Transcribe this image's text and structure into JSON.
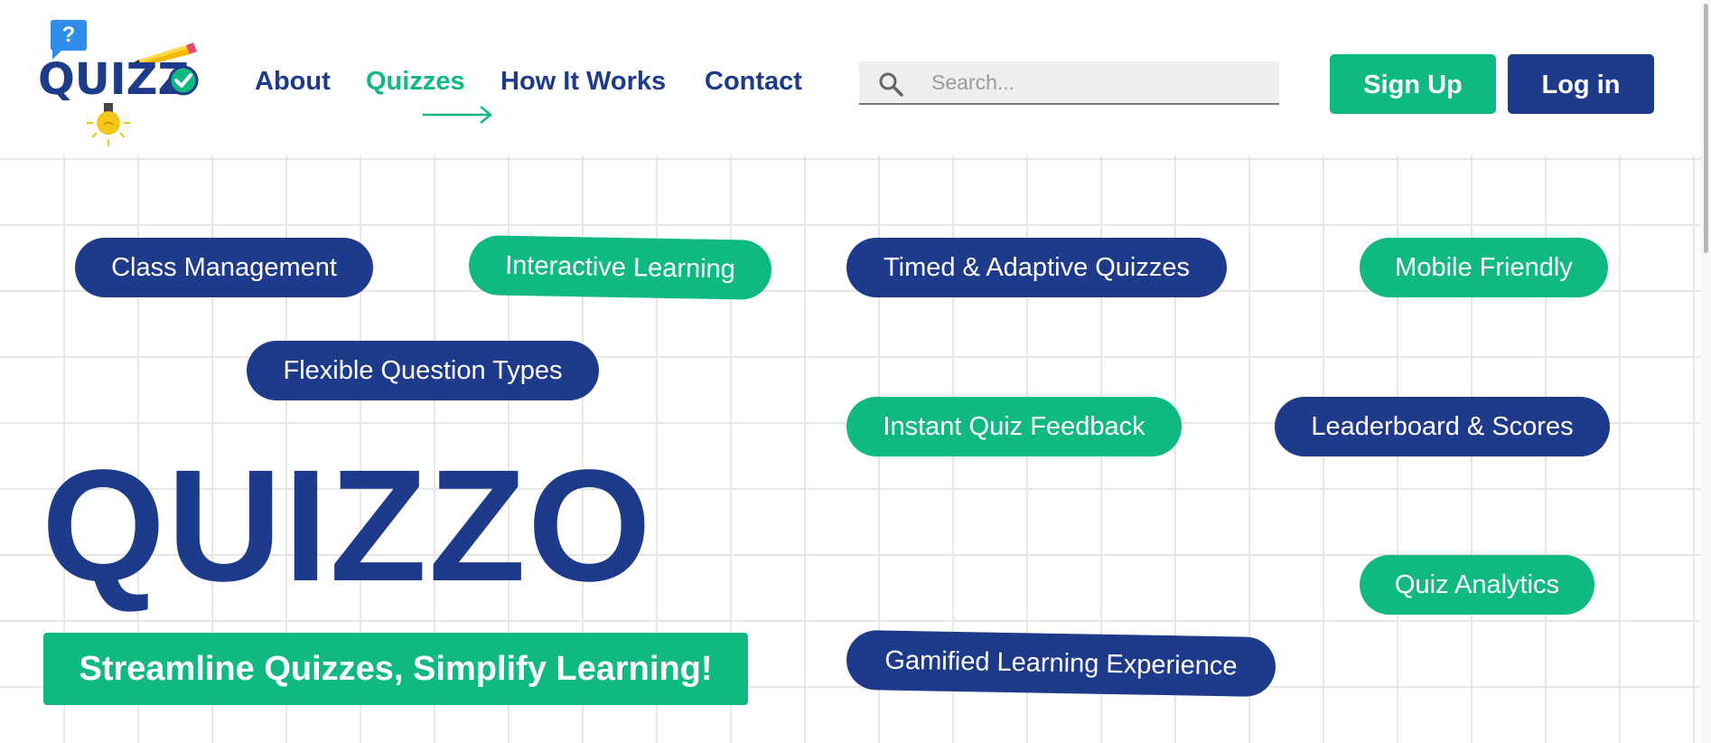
{
  "brand": {
    "logo_text": "QUIZZ",
    "logo_bubble": "?",
    "title": "QUIZZO",
    "tagline": "Streamline Quizzes, Simplify Learning!",
    "colors": {
      "primary": "#1e3a8a",
      "accent": "#10b981",
      "bubble": "#2f8ce8",
      "bulb": "#f5c518"
    }
  },
  "nav": {
    "items": [
      {
        "label": "About",
        "active": false
      },
      {
        "label": "Quizzes",
        "active": true
      },
      {
        "label": "How It Works",
        "active": false
      },
      {
        "label": "Contact",
        "active": false
      }
    ]
  },
  "search": {
    "placeholder": "Search...",
    "value": "",
    "icon": "search-icon"
  },
  "auth": {
    "signup_label": "Sign Up",
    "login_label": "Log in"
  },
  "features": [
    {
      "label": "Class Management",
      "color": "blue"
    },
    {
      "label": "Interactive Learning",
      "color": "green"
    },
    {
      "label": "Timed & Adaptive Quizzes",
      "color": "blue"
    },
    {
      "label": "Mobile Friendly",
      "color": "green"
    },
    {
      "label": "Flexible Question Types",
      "color": "blue"
    },
    {
      "label": "Instant Quiz Feedback",
      "color": "green"
    },
    {
      "label": "Leaderboard & Scores",
      "color": "blue"
    },
    {
      "label": "Quiz Analytics",
      "color": "green"
    },
    {
      "label": "Gamified Learning Experience",
      "color": "blue"
    }
  ]
}
